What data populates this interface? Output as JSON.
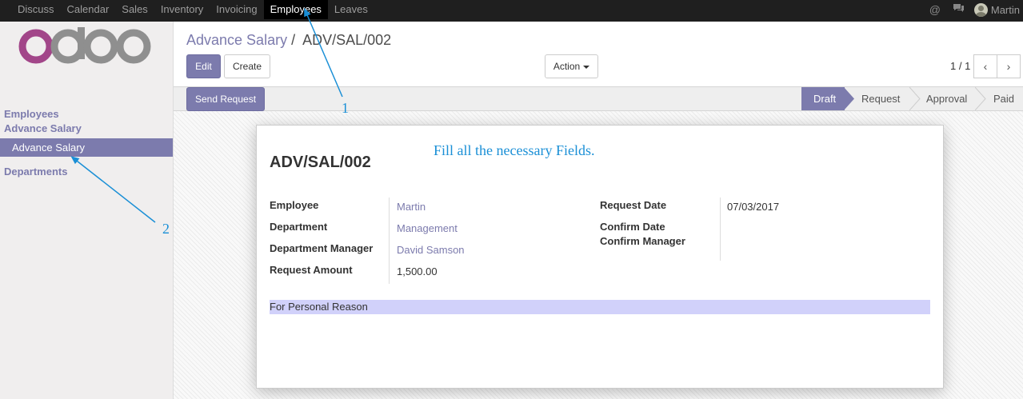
{
  "topbar": {
    "menu": [
      "Discuss",
      "Calendar",
      "Sales",
      "Inventory",
      "Invoicing",
      "Employees",
      "Leaves"
    ],
    "active": "Employees",
    "user": "Martin",
    "icons": [
      "at-icon",
      "chat-icon"
    ]
  },
  "sidebar": {
    "section_employees": "Employees",
    "section_advance_salary": "Advance Salary",
    "item_advance_salary": "Advance Salary",
    "section_departments": "Departments"
  },
  "breadcrumb": {
    "parent": "Advance Salary",
    "separator": "/",
    "current": "ADV/SAL/002"
  },
  "toolbar": {
    "edit": "Edit",
    "create": "Create",
    "action": "Action",
    "pager": "1 / 1",
    "prev": "‹",
    "next": "›"
  },
  "statusbar": {
    "button": "Send Request",
    "stages": [
      "Draft",
      "Request",
      "Approval",
      "Paid"
    ],
    "active_stage": "Draft"
  },
  "form": {
    "reference": "ADV/SAL/002",
    "left": [
      {
        "label": "Employee",
        "value": "Martin"
      },
      {
        "label": "Department",
        "value": "Management"
      },
      {
        "label": "Department Manager",
        "value": "David Samson"
      },
      {
        "label": "Request Amount",
        "value": "1,500.00"
      }
    ],
    "right": [
      {
        "label": "Request Date",
        "value": "07/03/2017"
      },
      {
        "label": "Confirm Date",
        "value": ""
      },
      {
        "label": "Confirm Manager",
        "value": ""
      }
    ],
    "reason": "For Personal Reason"
  },
  "annotations": {
    "instruction": "Fill all the necessary  Fields.",
    "marker_1": "1",
    "marker_2": "2"
  },
  "colors": {
    "accent": "#7c7bad",
    "annotation": "#1a8fd6",
    "topbar": "#1f1f1f"
  }
}
